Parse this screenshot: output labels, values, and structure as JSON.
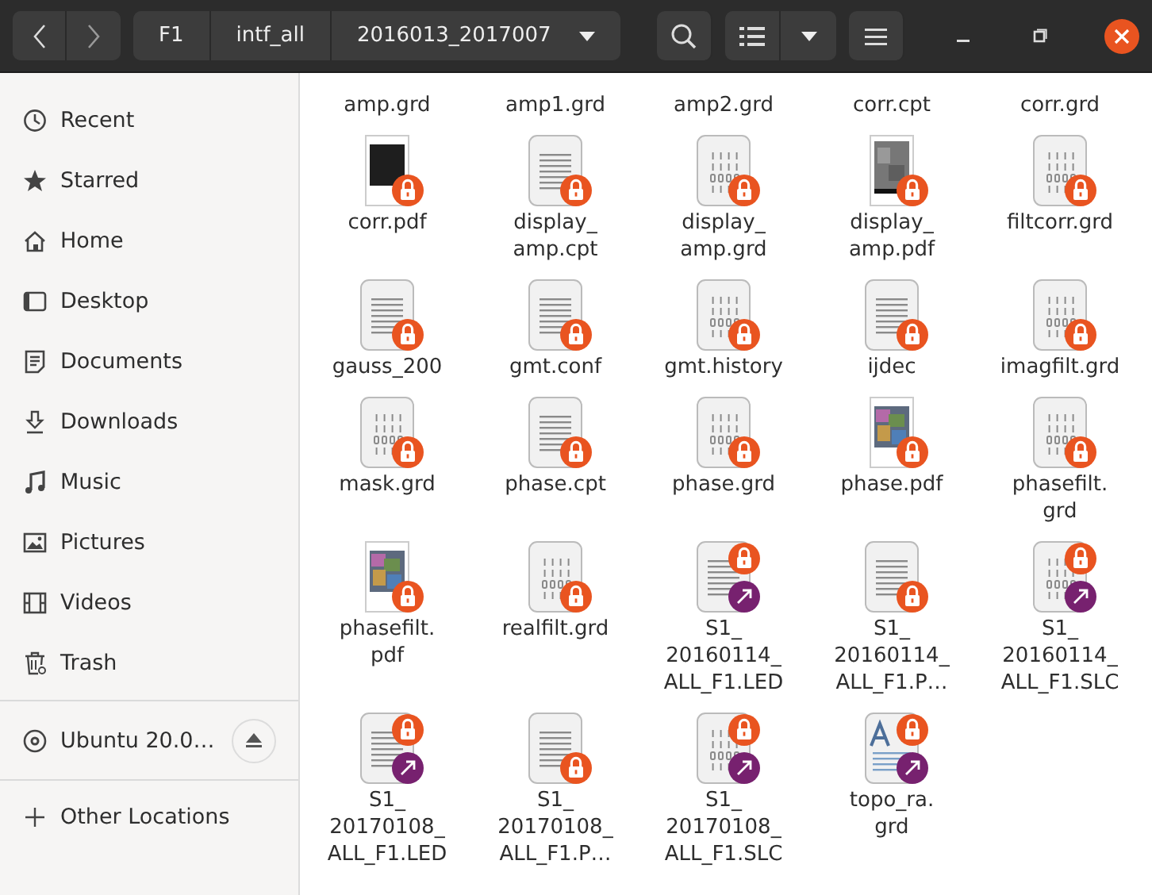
{
  "toolbar": {
    "path": [
      "F1",
      "intf_all",
      "2016013_2017007"
    ]
  },
  "sidebar": {
    "places": [
      {
        "label": "Recent",
        "kind": "recent"
      },
      {
        "label": "Starred",
        "kind": "star"
      },
      {
        "label": "Home",
        "kind": "home"
      },
      {
        "label": "Desktop",
        "kind": "desktop"
      },
      {
        "label": "Documents",
        "kind": "documents"
      },
      {
        "label": "Downloads",
        "kind": "downloads"
      },
      {
        "label": "Music",
        "kind": "music"
      },
      {
        "label": "Pictures",
        "kind": "pictures"
      },
      {
        "label": "Videos",
        "kind": "videos"
      },
      {
        "label": "Trash",
        "kind": "trash"
      }
    ],
    "devices": [
      {
        "label": "Ubuntu 20.0…",
        "kind": "disc",
        "eject": true
      }
    ],
    "other": [
      {
        "label": "Other Locations",
        "kind": "plus"
      }
    ]
  },
  "files": [
    {
      "lines": [
        "amp.grd"
      ]
    },
    {
      "lines": [
        "amp1.grd"
      ]
    },
    {
      "lines": [
        "amp2.grd"
      ]
    },
    {
      "lines": [
        "corr.cpt"
      ]
    },
    {
      "lines": [
        "corr.grd"
      ]
    },
    {
      "lines": [
        "corr.pdf"
      ],
      "kind": "pdf_dark",
      "locked": true,
      "link": false
    },
    {
      "lines": [
        "display_",
        "amp.cpt"
      ],
      "kind": "text",
      "locked": true,
      "link": false
    },
    {
      "lines": [
        "display_",
        "amp.grd"
      ],
      "kind": "binary",
      "locked": true,
      "link": false
    },
    {
      "lines": [
        "display_",
        "amp.pdf"
      ],
      "kind": "pdf_gray",
      "locked": true,
      "link": false
    },
    {
      "lines": [
        "filtcorr.grd"
      ],
      "kind": "binary",
      "locked": true,
      "link": false
    },
    {
      "lines": [
        "gauss_200"
      ],
      "kind": "text",
      "locked": true,
      "link": false
    },
    {
      "lines": [
        "gmt.conf"
      ],
      "kind": "text",
      "locked": true,
      "link": false
    },
    {
      "lines": [
        "gmt.history"
      ],
      "kind": "binary",
      "locked": true,
      "link": false
    },
    {
      "lines": [
        "ijdec"
      ],
      "kind": "text",
      "locked": true,
      "link": false
    },
    {
      "lines": [
        "imagfilt.grd"
      ],
      "kind": "binary",
      "locked": true,
      "link": false
    },
    {
      "lines": [
        "mask.grd"
      ],
      "kind": "binary",
      "locked": true,
      "link": false
    },
    {
      "lines": [
        "phase.cpt"
      ],
      "kind": "text",
      "locked": true,
      "link": false
    },
    {
      "lines": [
        "phase.grd"
      ],
      "kind": "binary",
      "locked": true,
      "link": false
    },
    {
      "lines": [
        "phase.pdf"
      ],
      "kind": "pdf_color",
      "locked": true,
      "link": false
    },
    {
      "lines": [
        "phasefilt.",
        "grd"
      ],
      "kind": "binary",
      "locked": true,
      "link": false
    },
    {
      "lines": [
        "phasefilt.",
        "pdf"
      ],
      "kind": "pdf_color",
      "locked": true,
      "link": false
    },
    {
      "lines": [
        "realfilt.grd"
      ],
      "kind": "binary",
      "locked": true,
      "link": false
    },
    {
      "lines": [
        "S1_",
        "20160114_",
        "ALL_F1.LED"
      ],
      "kind": "text",
      "locked": true,
      "link": true
    },
    {
      "lines": [
        "S1_",
        "20160114_",
        "ALL_F1.P…"
      ],
      "kind": "text",
      "locked": true,
      "link": false
    },
    {
      "lines": [
        "S1_",
        "20160114_",
        "ALL_F1.SLC"
      ],
      "kind": "binary",
      "locked": true,
      "link": true
    },
    {
      "lines": [
        "S1_",
        "20170108_",
        "ALL_F1.LED"
      ],
      "kind": "text",
      "locked": true,
      "link": true
    },
    {
      "lines": [
        "S1_",
        "20170108_",
        "ALL_F1.P…"
      ],
      "kind": "text",
      "locked": true,
      "link": false
    },
    {
      "lines": [
        "S1_",
        "20170108_",
        "ALL_F1.SLC"
      ],
      "kind": "binary",
      "locked": true,
      "link": true
    },
    {
      "lines": [
        "topo_ra.",
        "grd"
      ],
      "kind": "doc",
      "locked": true,
      "link": true
    }
  ]
}
